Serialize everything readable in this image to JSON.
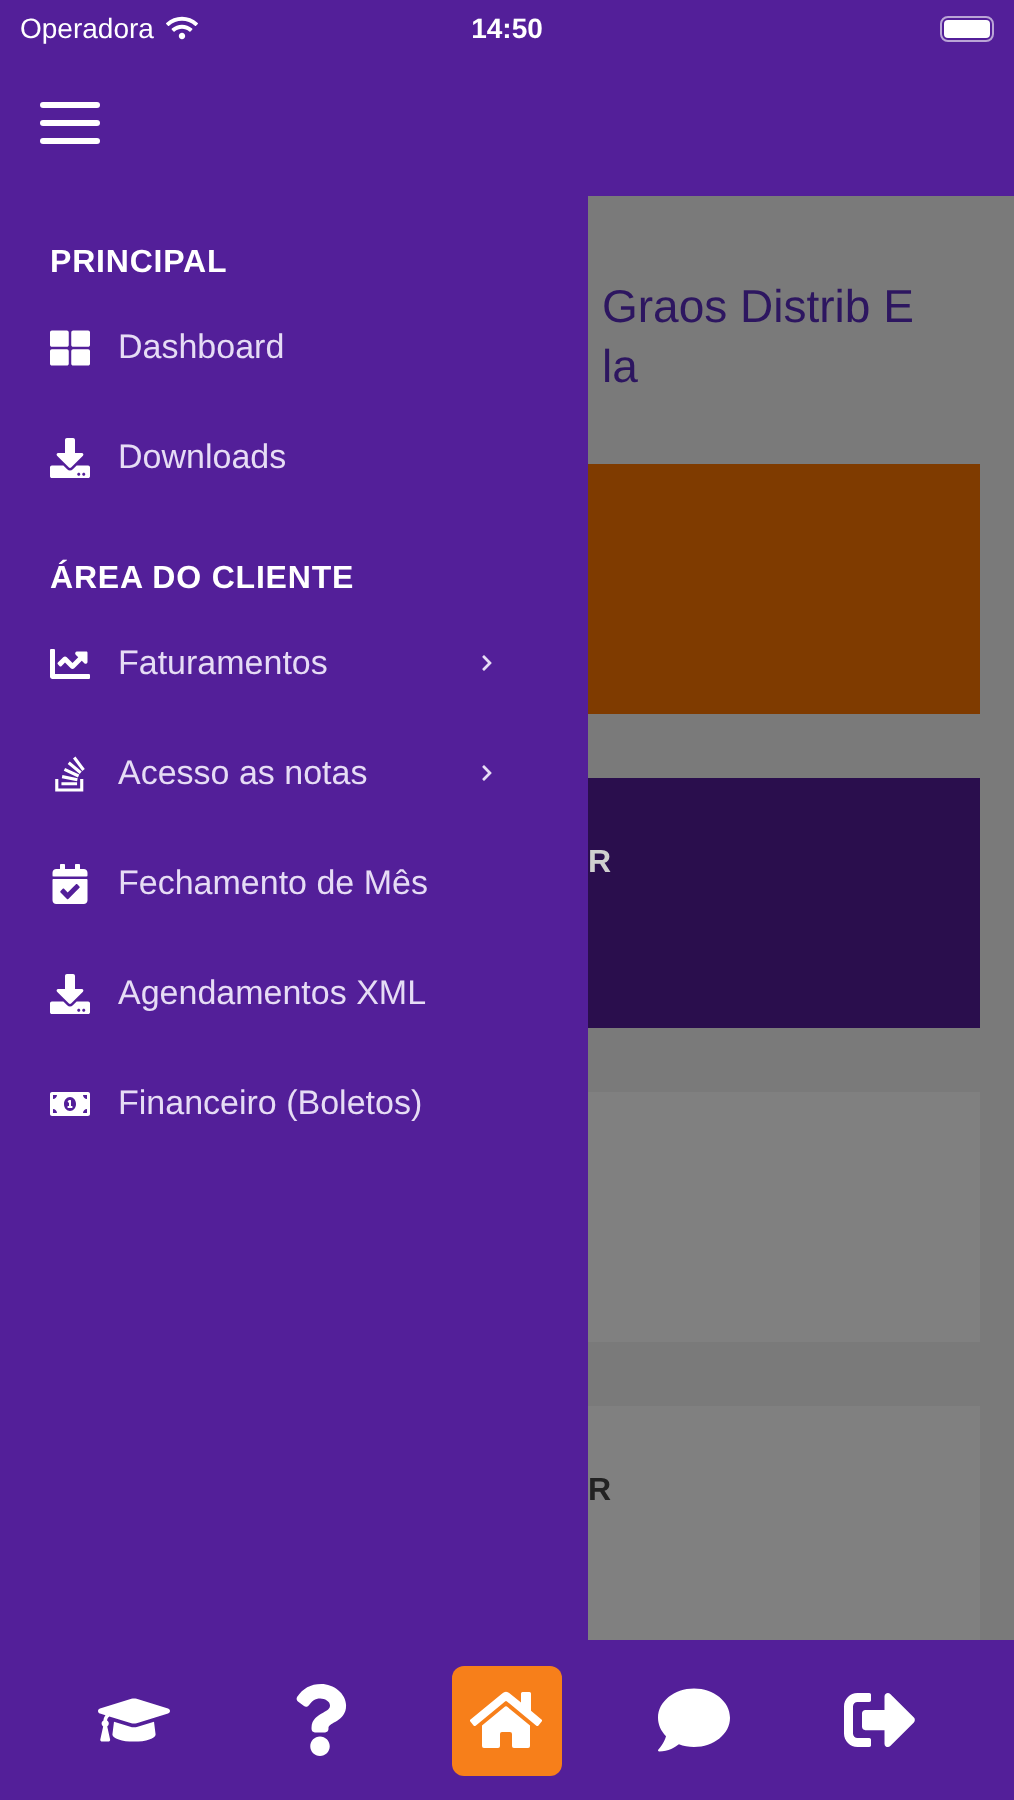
{
  "status_bar": {
    "carrier": "Operadora",
    "time": "14:50"
  },
  "menu": {
    "sections": [
      {
        "title": "PRINCIPAL",
        "items": [
          {
            "label": "Dashboard",
            "expandable": false
          },
          {
            "label": "Downloads",
            "expandable": false
          }
        ]
      },
      {
        "title": "ÁREA DO CLIENTE",
        "items": [
          {
            "label": "Faturamentos",
            "expandable": true
          },
          {
            "label": "Acesso as notas",
            "expandable": true
          },
          {
            "label": "Fechamento de Mês",
            "expandable": false
          },
          {
            "label": "Agendamentos XML",
            "expandable": false
          },
          {
            "label": "Financeiro (Boletos)",
            "expandable": false
          }
        ]
      }
    ]
  },
  "background_page": {
    "title_lines": [
      "Graos Distrib E",
      "la"
    ],
    "cards": [
      {
        "color": "#7f3b00"
      },
      {
        "color": "#2a0e4d",
        "label": "R"
      },
      {
        "color": "#808080"
      },
      {
        "color": "#808080",
        "label": "R"
      }
    ]
  },
  "bottom_nav": [
    {
      "selected": false
    },
    {
      "selected": false
    },
    {
      "selected": true
    },
    {
      "selected": false
    },
    {
      "selected": false
    }
  ]
}
